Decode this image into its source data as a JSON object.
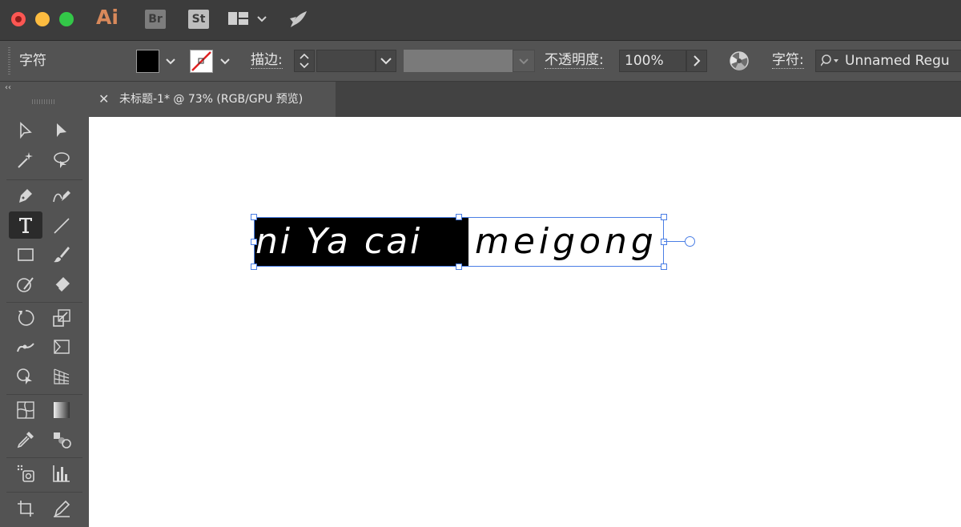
{
  "titlebar": {
    "app_name": "Ai",
    "bridge": "Br",
    "stock": "St"
  },
  "control_bar": {
    "panel_label": "字符",
    "stroke_label": "描边:",
    "opacity_label": "不透明度:",
    "opacity_value": "100%",
    "character_label": "字符:",
    "font_name": "Unnamed Regu"
  },
  "document": {
    "tab_title": "未标题-1* @ 73% (RGB/GPU 预览)",
    "close_glyph": "✕"
  },
  "canvas": {
    "text_selected": "ni Ya cai",
    "text_rest": "meigong"
  },
  "colors": {
    "fill": "#000000",
    "selection": "#4a7ee5"
  }
}
